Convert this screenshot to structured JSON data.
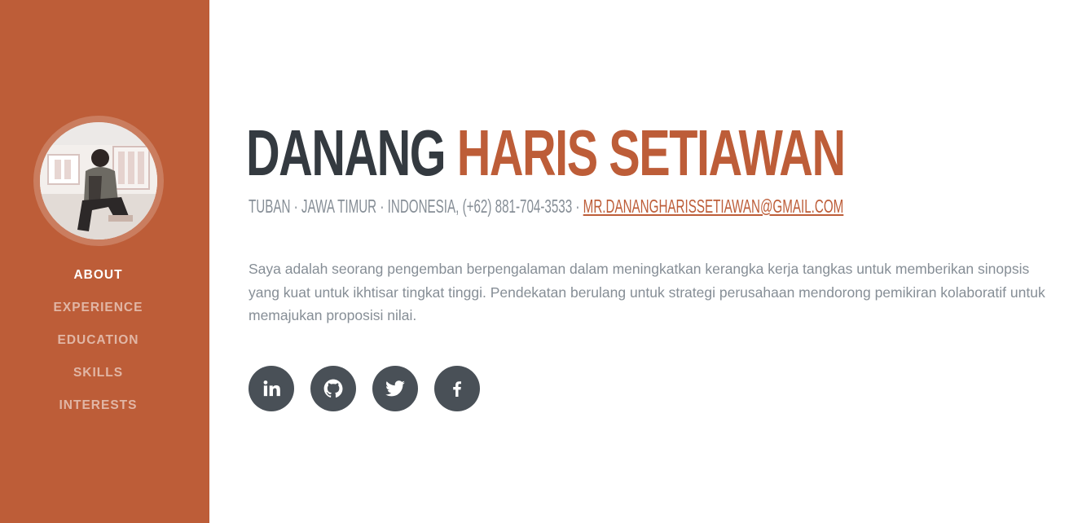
{
  "profile": {
    "first_name": "DANANG",
    "last_name": "HARIS SETIAWAN",
    "location": "TUBAN · JAWA TIMUR · INDONESIA, (+62) 881-704-3533 · ",
    "email": "MR.DANANGHARISSETIAWAN@GMAIL.COM",
    "bio": "Saya adalah seorang pengemban berpengalaman dalam meningkatkan kerangka kerja tangkas untuk memberikan sinopsis yang kuat untuk ikhtisar tingkat tinggi. Pendekatan berulang untuk strategi perusahaan mendorong pemikiran kolaboratif untuk memajukan proposisi nilai."
  },
  "sidebar": {
    "items": [
      {
        "label": "ABOUT",
        "active": true
      },
      {
        "label": "EXPERIENCE",
        "active": false
      },
      {
        "label": "EDUCATION",
        "active": false
      },
      {
        "label": "SKILLS",
        "active": false
      },
      {
        "label": "INTERESTS",
        "active": false
      }
    ]
  },
  "socials": [
    {
      "name": "linkedin-icon"
    },
    {
      "name": "github-icon"
    },
    {
      "name": "twitter-icon"
    },
    {
      "name": "facebook-icon"
    }
  ],
  "colors": {
    "primary": "#bd5d38",
    "dark": "#343a40",
    "muted": "#868e96",
    "icon_bg": "#495057"
  }
}
